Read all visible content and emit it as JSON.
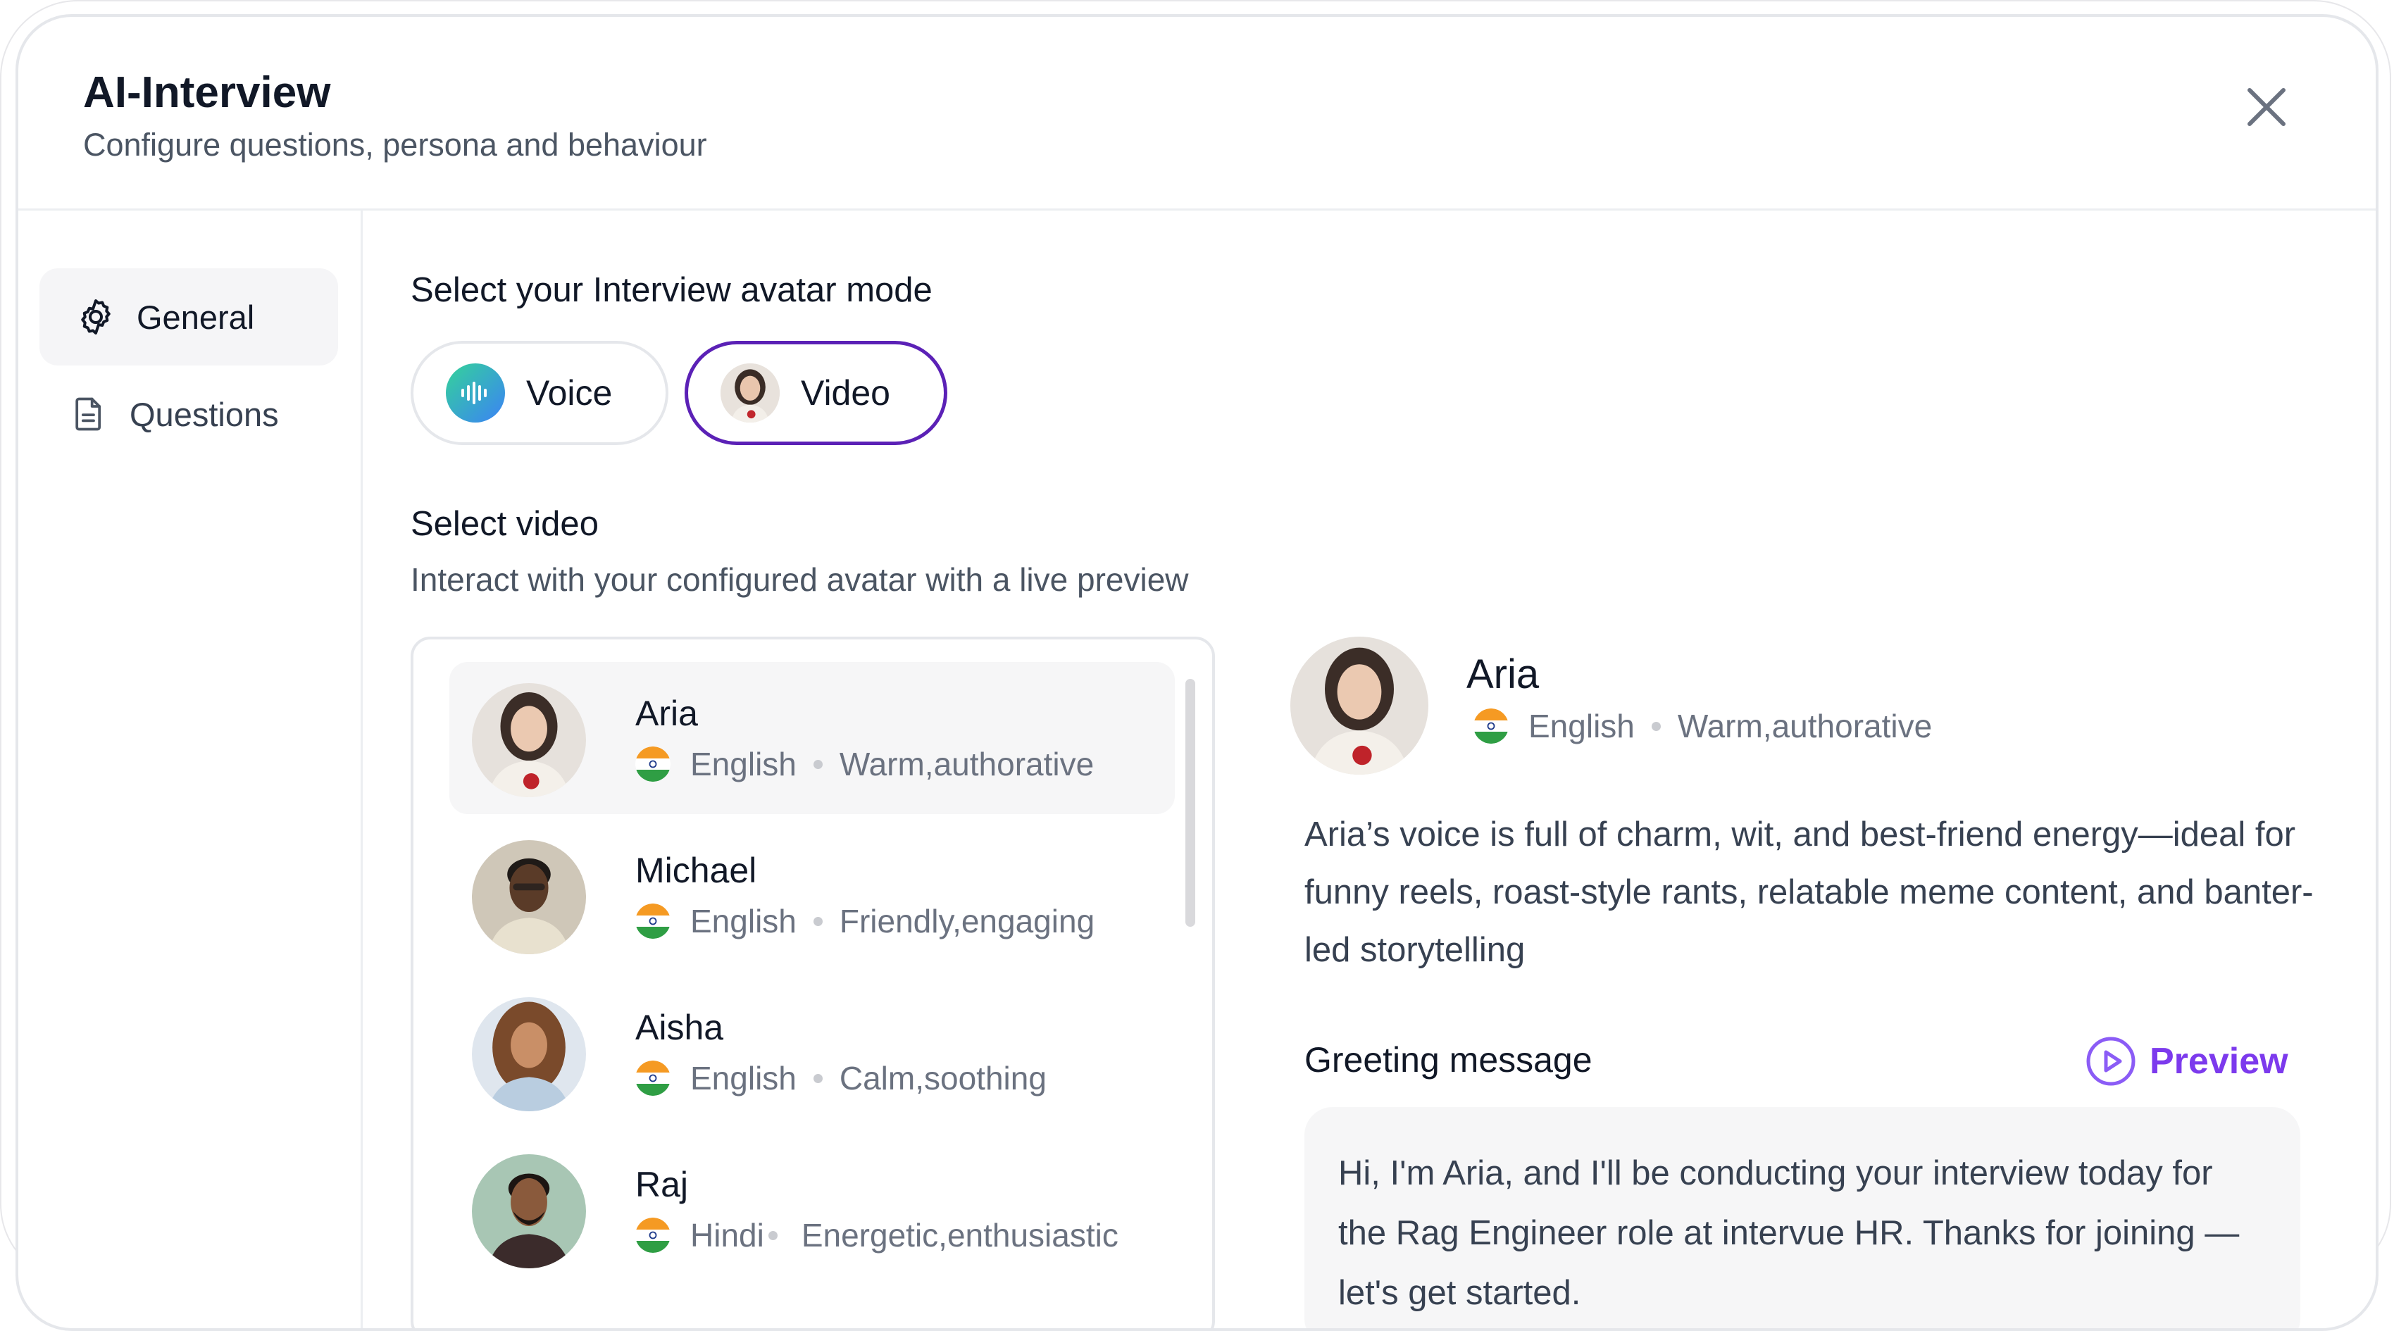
{
  "header": {
    "title": "AI-Interview",
    "subtitle": "Configure questions, persona and behaviour",
    "close_icon": "close-icon"
  },
  "sidebar": {
    "items": [
      {
        "label": "General",
        "icon": "gear-icon",
        "active": true
      },
      {
        "label": "Questions",
        "icon": "document-icon",
        "active": false
      }
    ]
  },
  "mode": {
    "heading": "Select your Interview avatar mode",
    "options": [
      {
        "label": "Voice",
        "icon": "waveform-icon",
        "selected": false
      },
      {
        "label": "Video",
        "icon": "avatar-thumbnail",
        "selected": true
      }
    ]
  },
  "video": {
    "heading": "Select video",
    "subheading": "Interact with your configured avatar with a live preview"
  },
  "avatars": [
    {
      "name": "Aria",
      "language": "English",
      "traits": "Warm,authorative",
      "selected": true
    },
    {
      "name": "Michael",
      "language": "English",
      "traits": "Friendly,engaging",
      "selected": false
    },
    {
      "name": "Aisha",
      "language": "English",
      "traits": "Calm,soothing",
      "selected": false
    },
    {
      "name": "Raj",
      "language": "Hindi",
      "traits": "Energetic,enthusiastic",
      "selected": false
    }
  ],
  "detail": {
    "name": "Aria",
    "language": "English",
    "traits": "Warm,authorative",
    "description": "Aria’s voice is full of charm, wit, and best-friend energy—ideal for funny reels, roast-style rants, relatable meme content, and banter-led storytelling",
    "greeting_label": "Greeting message",
    "preview_label": "Preview",
    "greeting_text": "Hi, I'm Aria, and I'll be conducting your interview today for the Rag Engineer role at intervue HR. Thanks for joining — let's get started."
  },
  "colors": {
    "accent": "#7c3aed",
    "selected_border": "#5b21b6",
    "border": "#e5e7eb",
    "selected_bg": "#f6f6f7"
  }
}
